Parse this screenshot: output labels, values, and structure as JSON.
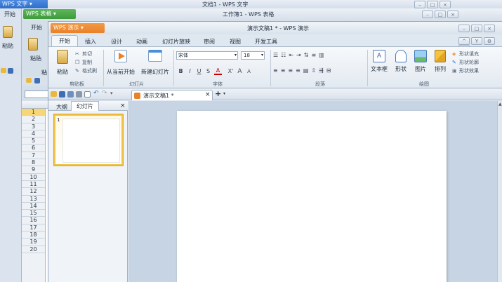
{
  "wps_writer": {
    "app_button": "WPS 文字",
    "doc_title": "文档1 - WPS 文字",
    "tab_home": "开始",
    "paste_label": "粘贴"
  },
  "wps_sheets": {
    "app_button": "WPS 表格",
    "doc_title": "工作簿1 - WPS 表格",
    "tab_home": "开始",
    "paste_label": "粘贴",
    "paste_label_short": "粘",
    "row_numbers": [
      "1",
      "2",
      "3",
      "4",
      "5",
      "6",
      "7",
      "8",
      "9",
      "10",
      "11",
      "12",
      "13",
      "14",
      "15",
      "16",
      "17",
      "18",
      "19",
      "20"
    ]
  },
  "wps_presentation": {
    "app_button": "WPS 演示",
    "doc_title": "演示文稿1 * - WPS 演示",
    "ribbon_tabs": [
      "开始",
      "插入",
      "设计",
      "动画",
      "幻灯片放映",
      "审阅",
      "视图",
      "开发工具"
    ],
    "clipboard": {
      "paste": "粘贴",
      "cut": "剪切",
      "copy": "复制",
      "format_painter": "格式刷",
      "group": "剪贴板"
    },
    "slides": {
      "from_current": "从当前开始",
      "new_slide": "新建幻灯片",
      "group": "幻灯片"
    },
    "font": {
      "name": "宋体",
      "size": "18",
      "group": "字体",
      "bold": "B",
      "italic": "I",
      "underline": "U",
      "strike": "S",
      "grow": "A",
      "shrink": "A"
    },
    "paragraph": {
      "group": "段落"
    },
    "drawing": {
      "textbox": "文本框",
      "shape": "形状",
      "picture": "图片",
      "arrange": "排列",
      "fill": "形状填充",
      "outline": "形状轮廓",
      "effect": "形状效果",
      "group": "绘图"
    },
    "doc_tab": "演示文稿1 *",
    "doc_tab_close": "×",
    "new_tab": "+",
    "panel_tabs": [
      "大纲",
      "幻灯片"
    ],
    "panel_close": "×",
    "slide_number": "1"
  },
  "colors": {
    "wps_writer_blue": "#2f6fc8",
    "wps_sheets_green": "#3f9a3c",
    "wps_presentation_orange": "#e8822a",
    "ribbon_bg": "#e4ebf3",
    "workspace_bg": "#c7d4e3"
  }
}
